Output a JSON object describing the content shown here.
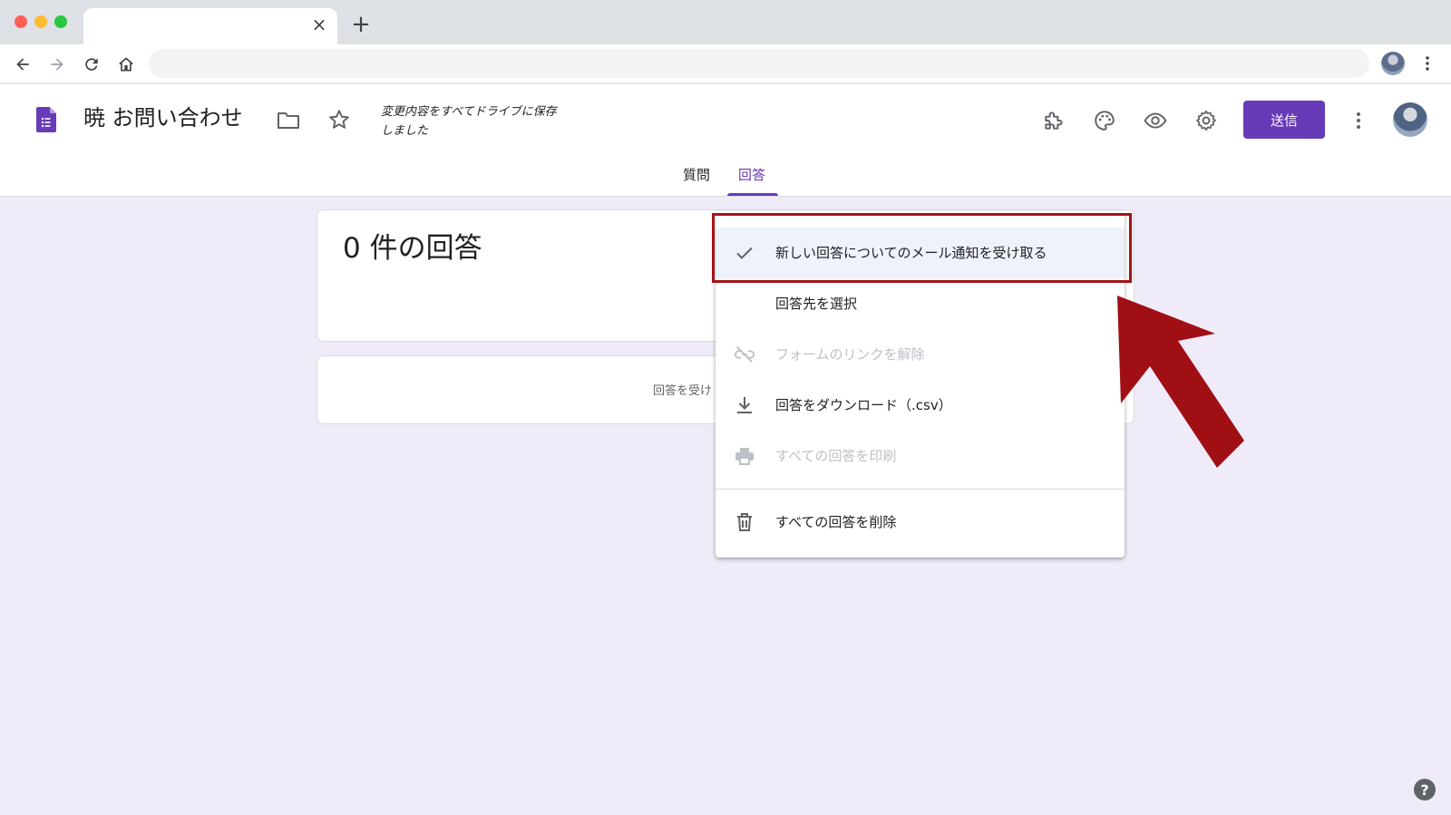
{
  "browser": {
    "tab_close_symbol": "×",
    "new_tab_symbol": "+",
    "nav_icons": [
      "back-arrow-icon",
      "forward-arrow-icon",
      "reload-icon",
      "home-icon"
    ]
  },
  "form": {
    "title": "暁 お問い合わせ",
    "save_status": "変更内容をすべてドライブに保存しました",
    "send_label": "送信",
    "header_icons": [
      "folder-icon",
      "star-icon",
      "addon-puzzle-icon",
      "palette-icon",
      "preview-eye-icon",
      "settings-gear-icon",
      "more-vert-icon"
    ],
    "tabs": [
      {
        "label": "質問",
        "active": false
      },
      {
        "label": "回答",
        "active": true
      }
    ],
    "accent_color": "#673ab7"
  },
  "responses": {
    "count_title": "0 件の回答",
    "accepting_text_visible": "回答を受け"
  },
  "menu": {
    "items": [
      {
        "label": "新しい回答についてのメール通知を受け取る",
        "icon": "check-icon",
        "disabled": false,
        "highlighted": true
      },
      {
        "label": "回答先を選択",
        "icon": "",
        "disabled": false,
        "highlighted": false
      },
      {
        "label": "フォームのリンクを解除",
        "icon": "link-off-icon",
        "disabled": true,
        "highlighted": false
      },
      {
        "label": "回答をダウンロード（.csv）",
        "icon": "download-icon",
        "disabled": false,
        "highlighted": false
      },
      {
        "label": "すべての回答を印刷",
        "icon": "print-icon",
        "disabled": true,
        "highlighted": false
      },
      {
        "label": "すべての回答を削除",
        "icon": "trash-icon",
        "disabled": false,
        "highlighted": false
      }
    ]
  },
  "annotation": {
    "box_color": "#a51218",
    "arrow_color": "#a00f14"
  },
  "help": {
    "symbol": "?"
  }
}
